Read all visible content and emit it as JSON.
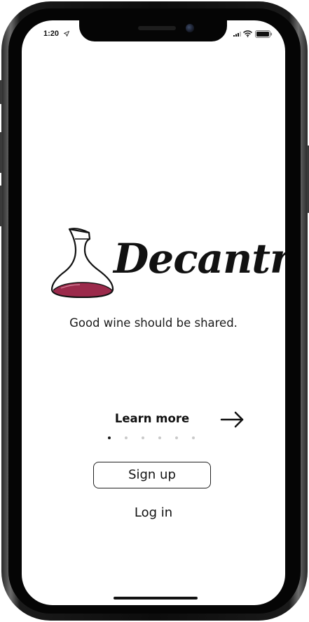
{
  "status_bar": {
    "time": "1:20",
    "location_icon": "location-arrow-icon",
    "signal_icon": "cellular-signal-icon",
    "wifi_icon": "wifi-icon",
    "battery_icon": "battery-icon"
  },
  "branding": {
    "app_name": "Decantr",
    "logo_icon": "decanter-icon",
    "tagline": "Good wine should be shared.",
    "wine_color": "#9b2a4b"
  },
  "onboarding": {
    "learn_more_label": "Learn more",
    "next_icon": "arrow-right-icon",
    "page_count": 6,
    "current_page": 1
  },
  "actions": {
    "signup_label": "Sign up",
    "login_label": "Log in"
  }
}
